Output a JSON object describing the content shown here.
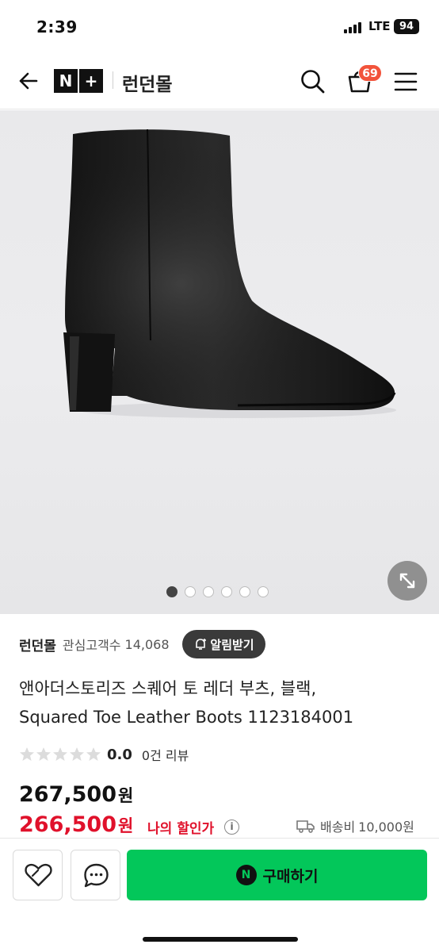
{
  "status_bar": {
    "time": "2:39",
    "network": "LTE",
    "battery": "94"
  },
  "header": {
    "back_icon": "arrow-left-icon",
    "logo_left": "N",
    "logo_right": "+",
    "store_name": "런던몰",
    "search_icon": "search-icon",
    "cart_icon": "shopping-bag-icon",
    "cart_badge": "69",
    "menu_icon": "hamburger-menu-icon"
  },
  "gallery": {
    "image_count": 6,
    "active_index": 0,
    "expand_icon": "expand-icon"
  },
  "seller": {
    "name": "런던몰",
    "followers_label": "관심고객수",
    "followers_count": "14,068",
    "alarm_label": "알림받기"
  },
  "product": {
    "title_line1": "앤아더스토리즈 스퀘어 토 레더 부츠, 블랙,",
    "title_line2": "Squared Toe Leather Boots 1123184001",
    "rating": "0.0",
    "review_count": "0건 리뷰",
    "price_original": "267,500",
    "price_discount": "266,500",
    "currency_unit": "원",
    "my_discount_label": "나의 할인가",
    "info_icon": "i",
    "shipping_label": "배송비",
    "shipping_fee": "10,000원"
  },
  "bottom_bar": {
    "wish_icon": "heart-icon",
    "talk_icon": "chat-bubble-icon",
    "npay_mark": "N",
    "buy_label": "구매하기"
  },
  "colors": {
    "buy_green": "#03c75a",
    "discount_red": "#e0112b",
    "badge_red": "#f2533b"
  }
}
